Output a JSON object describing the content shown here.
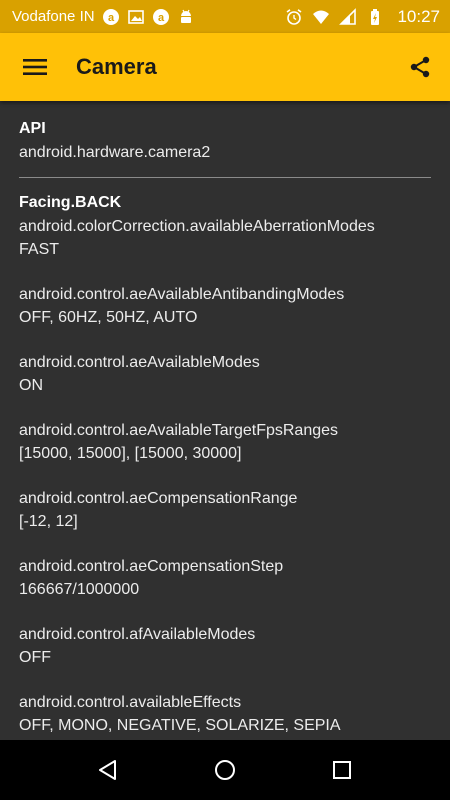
{
  "status_bar": {
    "carrier": "Vodafone IN",
    "time": "10:27",
    "icons": [
      "app-a-icon",
      "image-icon",
      "app-a-icon",
      "android-icon",
      "alarm-icon",
      "wifi-icon",
      "signal-icon",
      "battery-charging-icon"
    ]
  },
  "app_bar": {
    "title": "Camera",
    "menu_icon": "hamburger-menu-icon",
    "share_icon": "share-icon",
    "color": "#ffc107"
  },
  "api": {
    "title": "API",
    "value": "android.hardware.camera2"
  },
  "facing": {
    "title": "Facing.BACK",
    "properties": [
      {
        "key": "android.colorCorrection.availableAberrationModes",
        "value": "FAST"
      },
      {
        "key": "android.control.aeAvailableAntibandingModes",
        "value": "OFF, 60HZ, 50HZ, AUTO"
      },
      {
        "key": "android.control.aeAvailableModes",
        "value": "ON"
      },
      {
        "key": "android.control.aeAvailableTargetFpsRanges",
        "value": "[15000, 15000], [15000, 30000]"
      },
      {
        "key": "android.control.aeCompensationRange",
        "value": "[-12, 12]"
      },
      {
        "key": "android.control.aeCompensationStep",
        "value": "166667/1000000"
      },
      {
        "key": "android.control.afAvailableModes",
        "value": "OFF"
      },
      {
        "key": "android.control.availableEffects",
        "value": "OFF, MONO, NEGATIVE, SOLARIZE, SEPIA"
      }
    ]
  },
  "nav_bar": {
    "buttons": [
      "back-icon",
      "home-icon",
      "recents-icon"
    ]
  }
}
